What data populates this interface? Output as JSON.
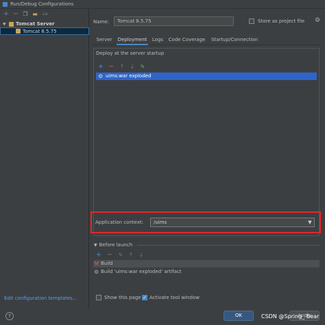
{
  "window": {
    "title": "Run/Debug Configurations"
  },
  "left_toolbar": {
    "icons": [
      "add-icon",
      "remove-icon",
      "copy-icon",
      "folder-icon",
      "sort-icon"
    ],
    "glyphs": [
      "+",
      "−",
      "❐",
      "▬",
      "↓a"
    ]
  },
  "tree": {
    "group_label": "Tomcat Server",
    "item_label": "Tomcat 8.5.75"
  },
  "edit_templates_label": "Edit configuration templates...",
  "config": {
    "name_label": "Name:",
    "name_value": "Tomcat 8.5.75",
    "store_label": "Store as project file"
  },
  "tabs": [
    "Server",
    "Deployment",
    "Logs",
    "Code Coverage",
    "Startup/Connection"
  ],
  "active_tab": "Deployment",
  "deploy": {
    "title": "Deploy at the server startup",
    "toolbar": [
      "+",
      "−",
      "↑",
      "↓",
      "✎"
    ],
    "items": [
      "uims:war exploded"
    ]
  },
  "context": {
    "label": "Application context:",
    "value": "/uims"
  },
  "before_launch": {
    "title": "Before launch",
    "toolbar": [
      "+",
      "−",
      "✎",
      "↑",
      "↓"
    ],
    "items": [
      "Build",
      "Build 'uims:war exploded' artifact"
    ]
  },
  "options": {
    "show_page_label": "Show this page",
    "activate_label": "Activate tool window"
  },
  "buttons": {
    "ok": "OK",
    "apply": "Apply"
  },
  "watermark": "CSDN @Spring_  Bear",
  "colors": {
    "accent": "#4a88c7",
    "highlight": "#e5272b",
    "selection": "#2f65ca"
  }
}
